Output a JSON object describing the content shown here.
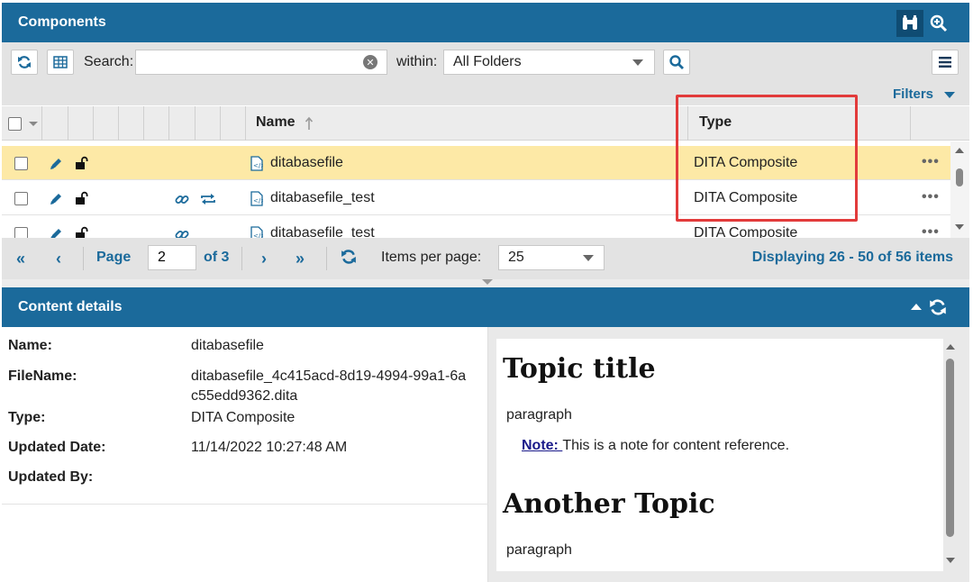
{
  "components": {
    "title": "Components",
    "icons": {
      "binoculars": "binoculars-icon",
      "zoom": "zoom-in-icon"
    }
  },
  "toolbar": {
    "search_label": "Search:",
    "search_value": "",
    "within_label": "within:",
    "within_value": "All Folders",
    "filters_label": "Filters"
  },
  "grid": {
    "columns": {
      "name": "Name",
      "type": "Type"
    },
    "rows": [
      {
        "name": "ditabasefile",
        "type": "DITA Composite",
        "more": "•••"
      },
      {
        "name": "ditabasefile_test",
        "type": "DITA Composite",
        "more": "•••"
      },
      {
        "name": "ditabasefile_test",
        "type": "DITA Composite",
        "more": "•••"
      }
    ]
  },
  "pager": {
    "page_label": "Page",
    "page_value": "2",
    "of_label": "of 3",
    "items_per_page_label": "Items per page:",
    "items_per_page_value": "25",
    "displaying": "Displaying 26 - 50 of 56 items"
  },
  "details": {
    "title": "Content details",
    "fields": {
      "name_label": "Name:",
      "name_value": "ditabasefile",
      "filename_label": "FileName:",
      "filename_value": "ditabasefile_4c415acd-8d19-4994-99a1-6ac55edd9362.dita",
      "type_label": "Type:",
      "type_value": "DITA Composite",
      "updated_date_label": "Updated Date:",
      "updated_date_value": "11/14/2022 10:27:48 AM",
      "updated_by_label": "Updated By:",
      "updated_by_value": ""
    }
  },
  "preview": {
    "topic1_title": "Topic title",
    "topic1_para": "paragraph",
    "note_label": "Note: ",
    "note_text": "This is a note for content reference.",
    "topic2_title": "Another Topic",
    "topic2_para": "paragraph"
  },
  "colors": {
    "header_blue": "#1b6a9b",
    "selected_row": "#fde9a6",
    "highlight_red": "#e23b3b"
  }
}
